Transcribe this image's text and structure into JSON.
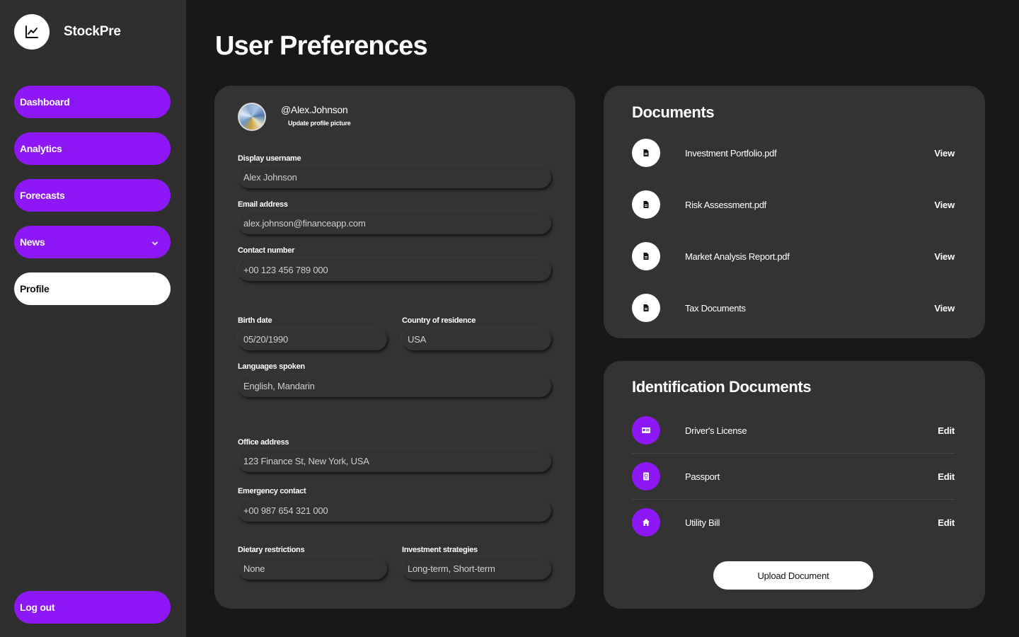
{
  "app": {
    "name": "StockPre",
    "logo_icon": "chart-line-icon"
  },
  "sidebar": {
    "items": [
      {
        "label": "Dashboard"
      },
      {
        "label": "Analytics"
      },
      {
        "label": "Forecasts"
      },
      {
        "label": "News",
        "has_dropdown": true
      },
      {
        "label": "Profile",
        "active": true
      }
    ],
    "logout_label": "Log out"
  },
  "page": {
    "title": "User Preferences"
  },
  "profile": {
    "handle": "@Alex.Johnson",
    "update_picture_label": "Update profile picture",
    "fields": {
      "display_username": {
        "label": "Display username",
        "value": "Alex Johnson"
      },
      "email": {
        "label": "Email address",
        "value": "alex.johnson@financeapp.com"
      },
      "contact": {
        "label": "Contact number",
        "value": "+00 123 456 789 000"
      },
      "birth_date": {
        "label": "Birth date",
        "value": "05/20/1990"
      },
      "country": {
        "label": "Country of residence",
        "value": "USA"
      },
      "languages": {
        "label": "Languages spoken",
        "value": "English, Mandarin"
      },
      "office": {
        "label": "Office address",
        "value": "123 Finance St, New York, USA"
      },
      "emergency": {
        "label": "Emergency contact",
        "value": "+00 987 654 321 000"
      },
      "dietary": {
        "label": "Dietary restrictions",
        "value": "None"
      },
      "investment": {
        "label": "Investment strategies",
        "value": "Long-term, Short-term"
      }
    }
  },
  "documents": {
    "title": "Documents",
    "items": [
      {
        "name": "Investment Portfolio.pdf",
        "action": "View",
        "icon": "file-icon"
      },
      {
        "name": "Risk Assessment.pdf",
        "action": "View",
        "icon": "file-icon"
      },
      {
        "name": "Market Analysis Report.pdf",
        "action": "View",
        "icon": "file-icon"
      },
      {
        "name": "Tax Documents",
        "action": "View",
        "icon": "file-icon"
      }
    ]
  },
  "identification": {
    "title": "Identification Documents",
    "items": [
      {
        "name": "Driver's License",
        "action": "Edit",
        "icon": "id-card-icon"
      },
      {
        "name": "Passport",
        "action": "Edit",
        "icon": "passport-icon"
      },
      {
        "name": "Utility Bill",
        "action": "Edit",
        "icon": "home-icon"
      }
    ],
    "upload_label": "Upload Document"
  },
  "colors": {
    "accent": "#8d18f5",
    "background": "#181818",
    "sidebar": "#2f2f2f",
    "card": "#333333"
  }
}
